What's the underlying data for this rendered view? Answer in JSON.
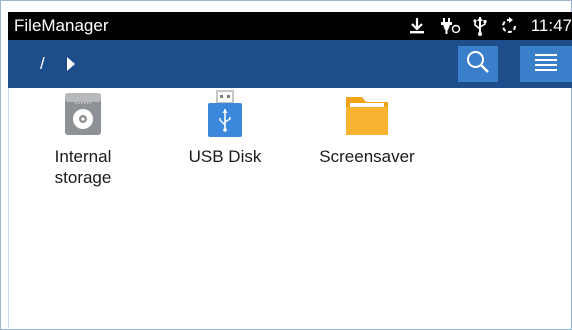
{
  "status_bar": {
    "app_title": "FileManager",
    "time": "11:47",
    "icons": [
      "download-icon",
      "power-plug-icon",
      "usb-icon",
      "sync-icon"
    ]
  },
  "toolbar": {
    "breadcrumb_root": "/",
    "buttons": [
      "search-icon",
      "menu-icon"
    ],
    "colors": {
      "toolbar": "#1e4d8c",
      "button": "#3a7fc9"
    }
  },
  "files": [
    {
      "label": "Internal\nstorage",
      "icon": "internal-storage-icon"
    },
    {
      "label": "USB Disk",
      "icon": "usb-disk-icon"
    },
    {
      "label": "Screensaver",
      "icon": "folder-icon"
    }
  ]
}
